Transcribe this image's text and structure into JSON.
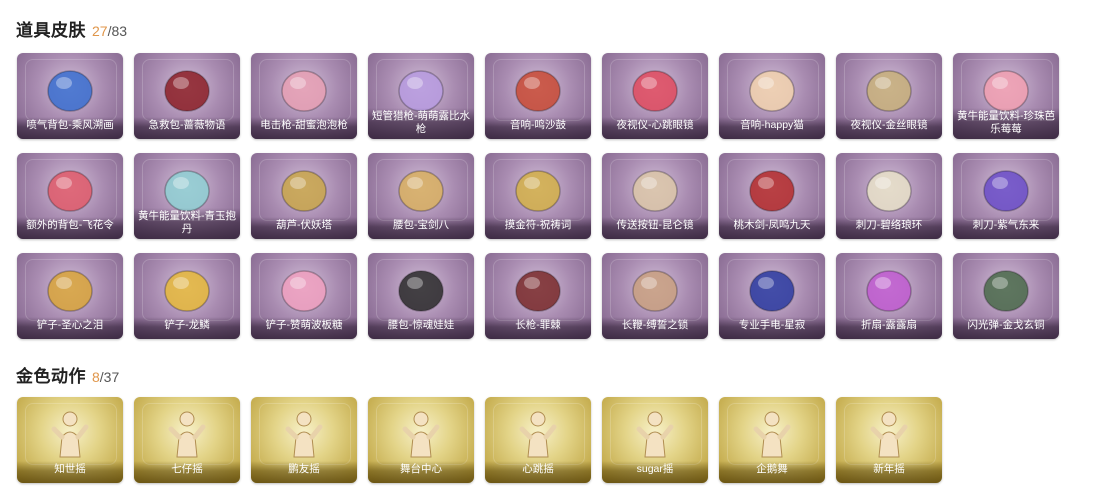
{
  "skins": {
    "title": "道具皮肤",
    "owned": "27",
    "total": "/83",
    "items": [
      {
        "label": "喷气背包-乘风溯画",
        "icon": "jetpack-icon",
        "color": "#3a6fd0"
      },
      {
        "label": "急救包-蔷薇物语",
        "icon": "firstaid-kit-icon",
        "color": "#8c1e26"
      },
      {
        "label": "电击枪-甜蜜泡泡枪",
        "icon": "bubble-gun-icon",
        "color": "#e7a0b4"
      },
      {
        "label": "短管猎枪-萌萌露比水枪",
        "icon": "water-gun-icon",
        "color": "#b79be0"
      },
      {
        "label": "音响-鸣沙鼓",
        "icon": "drum-speaker-icon",
        "color": "#c94a34"
      },
      {
        "label": "夜视仪-心跳眼镜",
        "icon": "heart-glasses-icon",
        "color": "#e04a5e"
      },
      {
        "label": "音响-happy猫",
        "icon": "cat-speaker-icon",
        "color": "#f2d2ae"
      },
      {
        "label": "夜视仪-金丝眼镜",
        "icon": "gold-glasses-icon",
        "color": "#c8b07a"
      },
      {
        "label": "黄牛能量饮料-珍珠芭乐莓莓",
        "icon": "drink-bottle-icon",
        "color": "#f2a0b2"
      },
      {
        "label": "额外的背包-飞花令",
        "icon": "flower-backpack-icon",
        "color": "#e05a6a"
      },
      {
        "label": "黄牛能量饮料-青玉抱丹",
        "icon": "jade-bottle-icon",
        "color": "#8fd0d4"
      },
      {
        "label": "葫芦-伏妖塔",
        "icon": "pagoda-icon",
        "color": "#c9a64a"
      },
      {
        "label": "腰包-宝剑八",
        "icon": "heart-pouch-icon",
        "color": "#d9b060"
      },
      {
        "label": "摸金符-祝祷词",
        "icon": "amulet-icon",
        "color": "#d4b048"
      },
      {
        "label": "传送按钮-昆仑镜",
        "icon": "mirror-icon",
        "color": "#dcc7a8"
      },
      {
        "label": "桃木剑-凤鸣九天",
        "icon": "red-sword-icon",
        "color": "#b42a2a"
      },
      {
        "label": "刺刀-碧络琅环",
        "icon": "jade-dagger-icon",
        "color": "#e8e0c8"
      },
      {
        "label": "刺刀-紫气东来",
        "icon": "purple-dagger-icon",
        "color": "#6a4cc8"
      },
      {
        "label": "铲子-圣心之泪",
        "icon": "shovel-heart-icon",
        "color": "#d9a53a"
      },
      {
        "label": "铲子-龙鳞",
        "icon": "dragon-shovel-icon",
        "color": "#e6b83a"
      },
      {
        "label": "铲子-赞萌波板糖",
        "icon": "lollipop-shovel-icon",
        "color": "#f0a0c0"
      },
      {
        "label": "腰包-惊魂娃娃",
        "icon": "skull-pouch-icon",
        "color": "#2a2a2a"
      },
      {
        "label": "长枪-罪棘",
        "icon": "spear-icon",
        "color": "#7a2a2a"
      },
      {
        "label": "长鞭-缚誓之锁",
        "icon": "chain-whip-icon",
        "color": "#c9a080"
      },
      {
        "label": "专业手电-星寂",
        "icon": "flashlight-icon",
        "color": "#2a3aa0"
      },
      {
        "label": "折扇-露露扇",
        "icon": "fan-icon",
        "color": "#c05ad0"
      },
      {
        "label": "闪光弹-金戈玄铜",
        "icon": "grenade-icon",
        "color": "#4a6a4a"
      }
    ]
  },
  "emotes": {
    "title": "金色动作",
    "owned": "8",
    "total": "/37",
    "items": [
      {
        "label": "知世摇",
        "icon": "pose-figure-icon"
      },
      {
        "label": "七仔摇",
        "icon": "pose-figure-icon"
      },
      {
        "label": "鹏友摇",
        "icon": "pose-figure-icon"
      },
      {
        "label": "舞台中心",
        "icon": "pose-figure-icon"
      },
      {
        "label": "心跳摇",
        "icon": "pose-figure-icon"
      },
      {
        "label": "sugar摇",
        "icon": "pose-figure-icon"
      },
      {
        "label": "企鹅舞",
        "icon": "pose-figure-icon"
      },
      {
        "label": "新年摇",
        "icon": "pose-figure-icon"
      }
    ]
  }
}
